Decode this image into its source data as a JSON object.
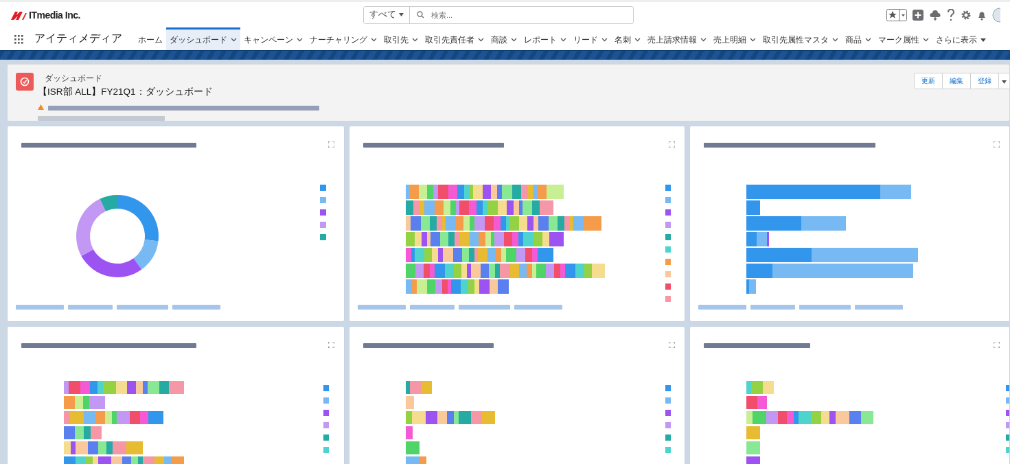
{
  "header": {
    "logo": "ITmedia Inc.",
    "search_scope": "すべて",
    "search": {
      "placeholder": "検索..."
    }
  },
  "nav": {
    "app_name": "アイティメディア",
    "tabs": [
      {
        "label": "ホーム",
        "selected": false,
        "kind": "link"
      },
      {
        "label": "ダッシュボード",
        "selected": true,
        "kind": "dropdown"
      },
      {
        "label": "キャンペーン",
        "selected": false,
        "kind": "dropdown"
      },
      {
        "label": "ナーチャリング",
        "selected": false,
        "kind": "dropdown"
      },
      {
        "label": "取引先",
        "selected": false,
        "kind": "dropdown"
      },
      {
        "label": "取引先責任者",
        "selected": false,
        "kind": "dropdown"
      },
      {
        "label": "商談",
        "selected": false,
        "kind": "dropdown"
      },
      {
        "label": "レポート",
        "selected": false,
        "kind": "dropdown"
      },
      {
        "label": "リード",
        "selected": false,
        "kind": "dropdown"
      },
      {
        "label": "名刺",
        "selected": false,
        "kind": "dropdown"
      },
      {
        "label": "売上請求情報",
        "selected": false,
        "kind": "dropdown"
      },
      {
        "label": "売上明細",
        "selected": false,
        "kind": "dropdown"
      },
      {
        "label": "取引先属性マスタ",
        "selected": false,
        "kind": "dropdown"
      },
      {
        "label": "商品",
        "selected": false,
        "kind": "dropdown"
      },
      {
        "label": "マーク属性",
        "selected": false,
        "kind": "dropdown"
      },
      {
        "label": "さらに表示",
        "selected": false,
        "kind": "more"
      }
    ]
  },
  "dashboard": {
    "type_label": "ダッシュボード",
    "title": "【ISR部 ALL】FY21Q1：ダッシュボード",
    "buttons": [
      "更新",
      "編集",
      "登録"
    ]
  },
  "panels": [
    {
      "kind": "donut"
    },
    {
      "kind": "stacked-bar"
    },
    {
      "kind": "two-tone-bar"
    },
    {
      "kind": "stacked-bar"
    },
    {
      "kind": "stacked-bar"
    },
    {
      "kind": "stacked-bar"
    }
  ]
}
